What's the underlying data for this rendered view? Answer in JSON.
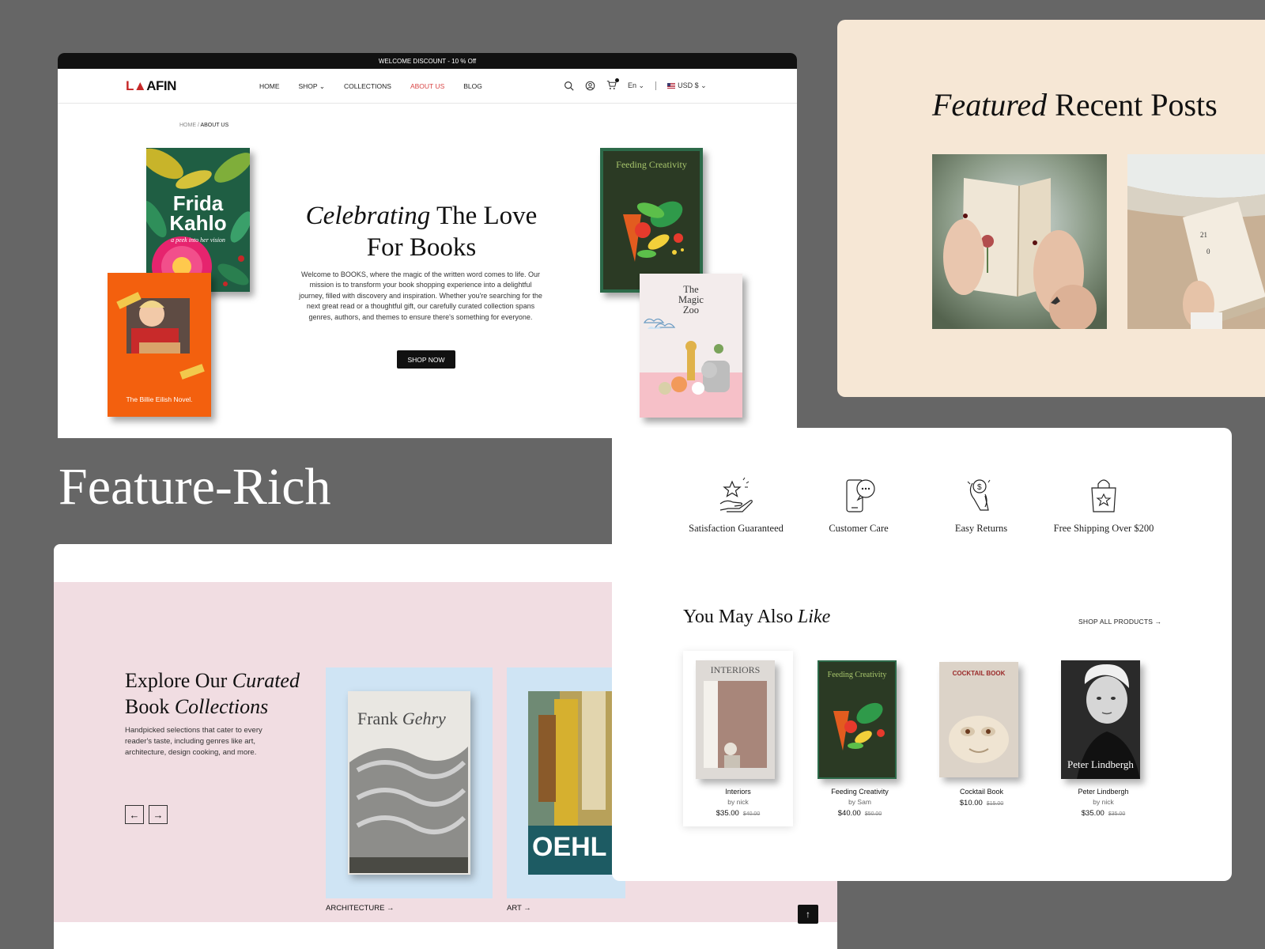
{
  "hero": {
    "announcement": "WELCOME DISCOUNT - 10 % Off",
    "logo": "LEAFIN",
    "nav": [
      "HOME",
      "SHOP",
      "COLLECTIONS",
      "ABOUT US",
      "BLOG"
    ],
    "language": "En",
    "currency": "USD $",
    "breadcrumb": {
      "home": "HOME",
      "current": "ABOUT US"
    },
    "title_italic": "Celebrating",
    "title_rest": "The Love For Books",
    "description": "Welcome to BOOKS, where the magic of the written word comes to life. Our mission is to transform your book shopping experience into a delightful journey, filled with discovery and inspiration. Whether you're searching for the next great read or a thoughtful gift, our carefully curated collection spans genres, authors, and themes to ensure there's something for everyone.",
    "cta": "SHOP NOW",
    "books": {
      "frida_title_1": "Frida",
      "frida_title_2": "Kahlo",
      "frida_subtitle": "a peek into her vision",
      "billie": "The Billie Eilish Novel.",
      "feeding": "Feeding Creativity",
      "zoo_1": "The",
      "zoo_2": "Magic",
      "zoo_3": "Zoo"
    }
  },
  "posts": {
    "title_italic": "Featured",
    "title_rest": "Recent Posts"
  },
  "caption": "Feature-Rich",
  "collections": {
    "title_a": "Explore Our",
    "title_b_italic": "Curated",
    "title_c": "Book",
    "title_d_italic": "Collections",
    "description": "Handpicked selections that cater to every reader's taste, including genres like art, architecture, design cooking, and more.",
    "prev_icon": "←",
    "next_icon": "→",
    "cards": [
      {
        "label": "ARCHITECTURE →",
        "cover_a": "Frank",
        "cover_b": "Gehry"
      },
      {
        "label": "ART →",
        "cover_a": "OEHL"
      }
    ],
    "back_to_top": "↑"
  },
  "features": [
    {
      "label": "Satisfaction Guaranteed",
      "icon": "hand-star-icon"
    },
    {
      "label": "Customer Care",
      "icon": "phone-chat-icon"
    },
    {
      "label": "Easy Returns",
      "icon": "return-money-icon"
    },
    {
      "label": "Free Shipping Over $200",
      "icon": "shopping-bag-star-icon"
    }
  ],
  "recommendations": {
    "title": "You May Also",
    "title_italic": "Like",
    "shop_all": "SHOP ALL PRODUCTS →",
    "products": [
      {
        "name": "Interiors",
        "by": "by nick",
        "price": "$35.00",
        "old": "$40.00",
        "cover_text": "INTERIORS"
      },
      {
        "name": "Feeding Creativity",
        "by": "by Sam",
        "price": "$40.00",
        "old": "$50.00",
        "cover_text": "Feeding Creativity"
      },
      {
        "name": "Cocktail Book",
        "by": "",
        "price": "$10.00",
        "old": "$15.00",
        "cover_text": "COCKTAIL BOOK"
      },
      {
        "name": "Peter Lindbergh",
        "by": "by nick",
        "price": "$35.00",
        "old": "$35.00",
        "cover_text": "Peter Lindbergh"
      }
    ]
  },
  "colors": {
    "background": "#666666",
    "accent_red": "#d84343",
    "cream": "#f6e7d5",
    "pink": "#f1dde2",
    "sky": "#cfe4f4"
  }
}
